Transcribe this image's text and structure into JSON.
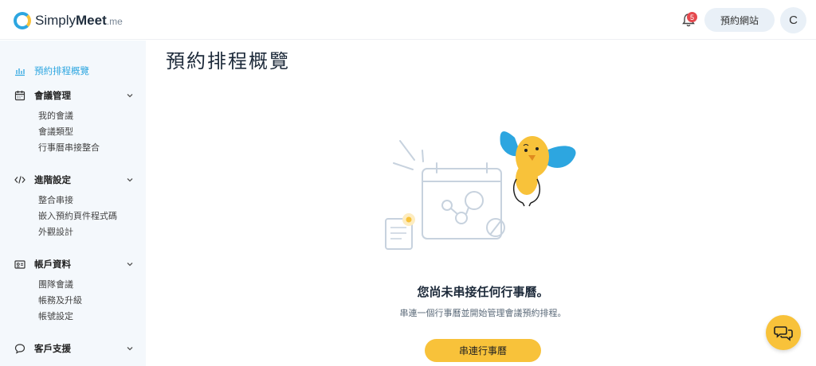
{
  "app": {
    "logo_main": "Simply",
    "logo_bold": "Meet",
    "logo_suffix": ".me"
  },
  "header": {
    "notification_count": "5",
    "site_button_label": "預約網站",
    "avatar_initial": "C",
    "accent_color": "#2da6e0",
    "cta_color": "#f8c23a"
  },
  "sidebar": {
    "active_item": {
      "label": "預約排程概覽",
      "icon": "bar-chart-icon"
    },
    "sections": [
      {
        "label": "會議管理",
        "icon": "calendar-icon",
        "items": [
          "我的會議",
          "會議類型",
          "行事曆串接整合"
        ]
      },
      {
        "label": "進階設定",
        "icon": "code-icon",
        "items": [
          "整合串接",
          "嵌入預約頁件程式碼",
          "外觀設計"
        ]
      },
      {
        "label": "帳戶資料",
        "icon": "id-card-icon",
        "items": [
          "團隊會議",
          "帳務及升級",
          "帳號設定"
        ]
      },
      {
        "label": "客戶支援",
        "icon": "chat-icon",
        "items": []
      }
    ]
  },
  "main": {
    "page_title": "預約排程概覽",
    "empty_title": "您尚未串接任何行事曆。",
    "empty_subtitle": "串連一個行事曆並開始管理會議預約排程。",
    "cta_label": "串連行事曆"
  }
}
